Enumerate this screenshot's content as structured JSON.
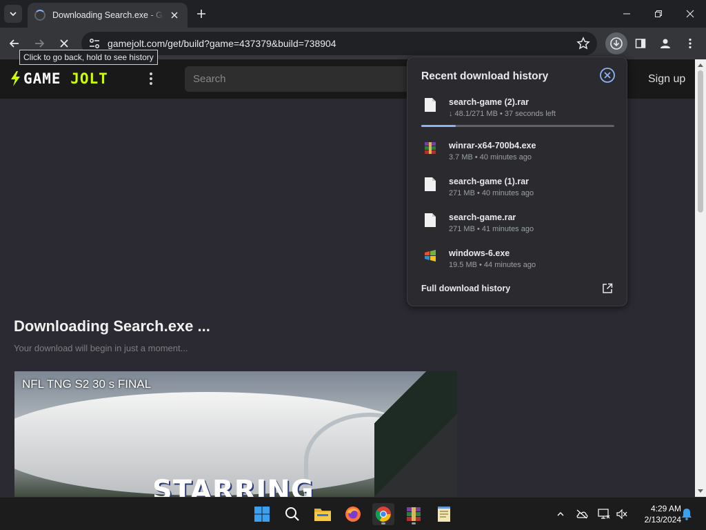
{
  "browser": {
    "tab_title": "Downloading Search.exe - Game Jolt",
    "url": "gamejolt.com/get/build?game=437379&build=738904",
    "back_tooltip": "Click to go back, hold to see history"
  },
  "icons": {
    "tab_search": "chevron-down-icon",
    "tab_close": "close-icon",
    "new_tab": "plus-icon",
    "minimize": "minimize-icon",
    "restore": "restore-icon",
    "close_window": "close-icon",
    "back": "arrow-left-icon",
    "forward": "arrow-right-icon",
    "stop": "stop-icon",
    "site_info": "tune-icon",
    "bookmark": "star-icon",
    "downloads": "download-icon",
    "side_panel": "side-panel-icon",
    "profile": "profile-icon",
    "menu": "kebab-menu-icon"
  },
  "site": {
    "logo_game": "GAME",
    "logo_jolt": "JOLT",
    "search_placeholder": "Search",
    "signup_label": "Sign up"
  },
  "main": {
    "heading": "Downloading Search.exe ...",
    "subtext": "Your download will begin in just a moment...",
    "video_title": "NFL TNG S2 30 s FINAL",
    "video_caption": "STARRING"
  },
  "downloads": {
    "title": "Recent download history",
    "full_history_label": "Full download history",
    "items": [
      {
        "name": "search-game (2).rar",
        "meta": "↓ 48.1/271 MB • 37 seconds left",
        "icon": "file-icon"
      },
      {
        "name": "winrar-x64-700b4.exe",
        "meta": "3.7 MB • 40 minutes ago",
        "icon": "winrar-icon"
      },
      {
        "name": "search-game (1).rar",
        "meta": "271 MB • 40 minutes ago",
        "icon": "file-icon"
      },
      {
        "name": "search-game.rar",
        "meta": "271 MB • 41 minutes ago",
        "icon": "file-icon"
      },
      {
        "name": "windows-6.exe",
        "meta": "19.5 MB • 44 minutes ago",
        "icon": "windows-logo-icon"
      }
    ],
    "active_progress_fraction": 0.177
  },
  "taskbar": {
    "apps": [
      "windows-start-icon",
      "search-icon",
      "file-explorer-icon",
      "firefox-icon",
      "chrome-icon",
      "winrar-icon",
      "notepad-icon"
    ],
    "tray": [
      "chevron-up-icon",
      "onedrive-icon",
      "network-icon",
      "volume-muted-icon",
      "notification-bell-icon"
    ],
    "time": "4:29 AM",
    "date": "2/13/2024"
  },
  "colors": {
    "accent": "#8ab4f8",
    "logo_accent": "#ccff00",
    "page_bg": "#2b2a33"
  }
}
